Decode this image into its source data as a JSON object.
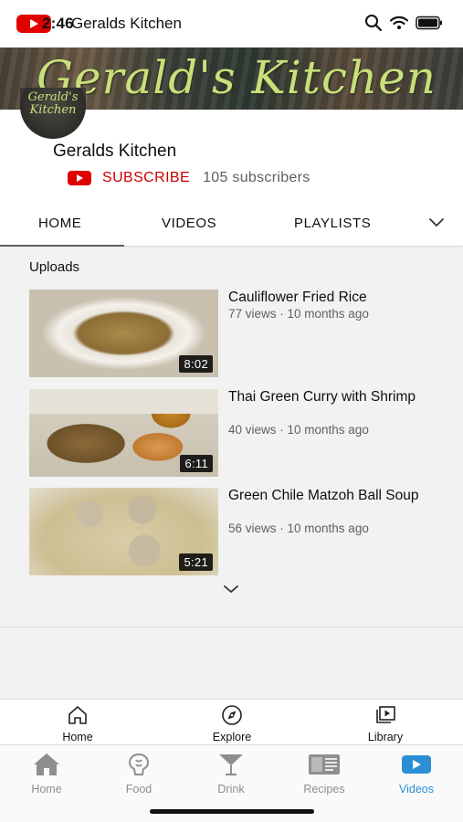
{
  "status_bar": {
    "time": "2:46",
    "title": "Geralds Kitchen",
    "icons": [
      "youtube-icon",
      "search-icon",
      "wifi-icon",
      "battery-icon"
    ]
  },
  "banner": {
    "title": "Gerald's Kitchen",
    "avatar_text": "Gerald's Kitchen"
  },
  "channel": {
    "name": "Geralds Kitchen",
    "subscribe_label": "SUBSCRIBE",
    "subscriber_count": "105 subscribers"
  },
  "tabs": [
    {
      "label": "HOME",
      "active": true
    },
    {
      "label": "VIDEOS",
      "active": false
    },
    {
      "label": "PLAYLISTS",
      "active": false
    }
  ],
  "uploads": {
    "label": "Uploads",
    "videos": [
      {
        "title": "Cauliflower Fried Rice",
        "meta": "77 views · 10 months ago",
        "duration": "8:02"
      },
      {
        "title": "Thai Green Curry with Shrimp",
        "meta": "40 views · 10 months ago",
        "duration": "6:11"
      },
      {
        "title": "Green Chile Matzoh Ball Soup",
        "meta": "56 views · 10 months ago",
        "duration": "5:21"
      }
    ]
  },
  "youtube_nav": [
    {
      "label": "Home",
      "icon": "home-outline-icon"
    },
    {
      "label": "Explore",
      "icon": "compass-icon"
    },
    {
      "label": "Library",
      "icon": "library-icon"
    }
  ],
  "app_tabs": [
    {
      "label": "Home",
      "icon": "home-icon",
      "active": false
    },
    {
      "label": "Food",
      "icon": "food-icon",
      "active": false
    },
    {
      "label": "Drink",
      "icon": "cocktail-icon",
      "active": false
    },
    {
      "label": "Recipes",
      "icon": "recipes-icon",
      "active": false
    },
    {
      "label": "Videos",
      "icon": "video-play-icon",
      "active": true
    }
  ],
  "colors": {
    "youtube_red": "#e00000",
    "subscribe_red": "#cc0000",
    "active_tab_blue": "#2c8fd6",
    "inactive_gray": "#8e8e8e",
    "banner_text": "#c9e07a"
  }
}
